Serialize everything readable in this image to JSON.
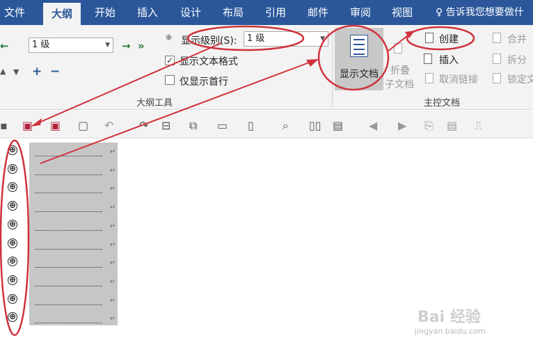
{
  "tabs": [
    "文件",
    "大纲",
    "开始",
    "插入",
    "设计",
    "布局",
    "引用",
    "邮件",
    "审阅",
    "视图"
  ],
  "active_tab": "大纲",
  "tell_me": "告诉我您想要做什",
  "outline_tools": {
    "level_combo_value": "1 级",
    "show_level_label": "显示级别(S):",
    "show_level_value": "1 级",
    "show_text_format": "显示文本格式",
    "show_first_line": "仅显示首行",
    "group_label": "大纲工具"
  },
  "master_doc": {
    "show_document": "显示文档",
    "collapse_line1": "折叠",
    "collapse_line2": "子文档",
    "create": "创建",
    "insert": "插入",
    "unlink": "取消链接",
    "merge": "合并",
    "split": "拆分",
    "lock": "锁定文",
    "group_label": "主控文档"
  },
  "outline_rows": {
    "count": 10,
    "plus_symbol": "⊕",
    "return_symbol": "↵"
  },
  "watermark": {
    "brand": "Bai 经验",
    "url": "jingyan.baidu.com"
  },
  "colors": {
    "accent": "#2b579a",
    "annotation": "#d0323c"
  }
}
